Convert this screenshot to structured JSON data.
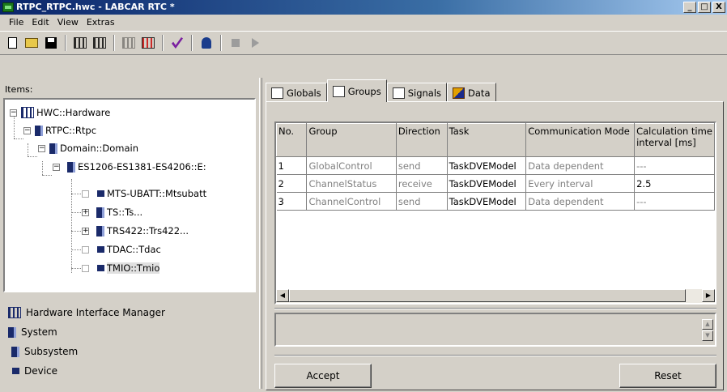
{
  "window": {
    "title": "RTPC_RTPC.hwc - LABCAR RTC  *",
    "controls": [
      "_",
      "□",
      "X"
    ]
  },
  "menu": [
    "File",
    "Edit",
    "View",
    "Extras"
  ],
  "toolbar": {
    "icons": [
      "new-file-icon",
      "open-folder-icon",
      "save-icon",
      "tree-icon",
      "tree-icon",
      "tree-disabled-icon",
      "tree-red-icon",
      "check-icon",
      "user-icon",
      "stop-icon",
      "play-icon"
    ]
  },
  "tree": {
    "label": "Items:",
    "nodes": [
      {
        "label": "HWC::Hardware",
        "type": "hardware",
        "expander": "minus"
      },
      {
        "label": "RTPC::Rtpc",
        "type": "system",
        "expander": "minus"
      },
      {
        "label": "Domain::Domain",
        "type": "system",
        "expander": "minus"
      },
      {
        "label": "ES1206-ES1381-ES4206::E:",
        "type": "subsystem",
        "expander": "minus"
      },
      {
        "label": "MTS-UBATT::Mtsubatt",
        "type": "device",
        "expander": "none"
      },
      {
        "label": "TS::Ts...",
        "type": "subsystem",
        "expander": "plus"
      },
      {
        "label": "TRS422::Trs422...",
        "type": "subsystem",
        "expander": "plus"
      },
      {
        "label": "TDAC::Tdac",
        "type": "device",
        "expander": "none"
      },
      {
        "label": "TMIO::Tmio",
        "type": "device",
        "expander": "none",
        "selected": true
      }
    ]
  },
  "legend": [
    {
      "label": "Hardware Interface Manager",
      "icon": "hardware-icon"
    },
    {
      "label": "System",
      "icon": "system-icon"
    },
    {
      "label": "Subsystem",
      "icon": "subsystem-icon"
    },
    {
      "label": "Device",
      "icon": "device-icon"
    }
  ],
  "tabs": [
    {
      "label": "Globals",
      "active": false
    },
    {
      "label": "Groups",
      "active": true
    },
    {
      "label": "Signals",
      "active": false
    },
    {
      "label": "Data",
      "active": false
    }
  ],
  "groups_table": {
    "columns": [
      "No.",
      "Group",
      "Direction",
      "Task",
      "Communication Mode",
      "Calculation time interval [ms]"
    ],
    "rows": [
      [
        "1",
        "GlobalControl",
        "send",
        "TaskDVEModel",
        "Data dependent",
        "---"
      ],
      [
        "2",
        "ChannelStatus",
        "receive",
        "TaskDVEModel",
        "Every interval",
        "2.5"
      ],
      [
        "3",
        "ChannelControl",
        "send",
        "TaskDVEModel",
        "Data dependent",
        "---"
      ]
    ]
  },
  "buttons": {
    "accept": "Accept",
    "reset": "Reset"
  }
}
